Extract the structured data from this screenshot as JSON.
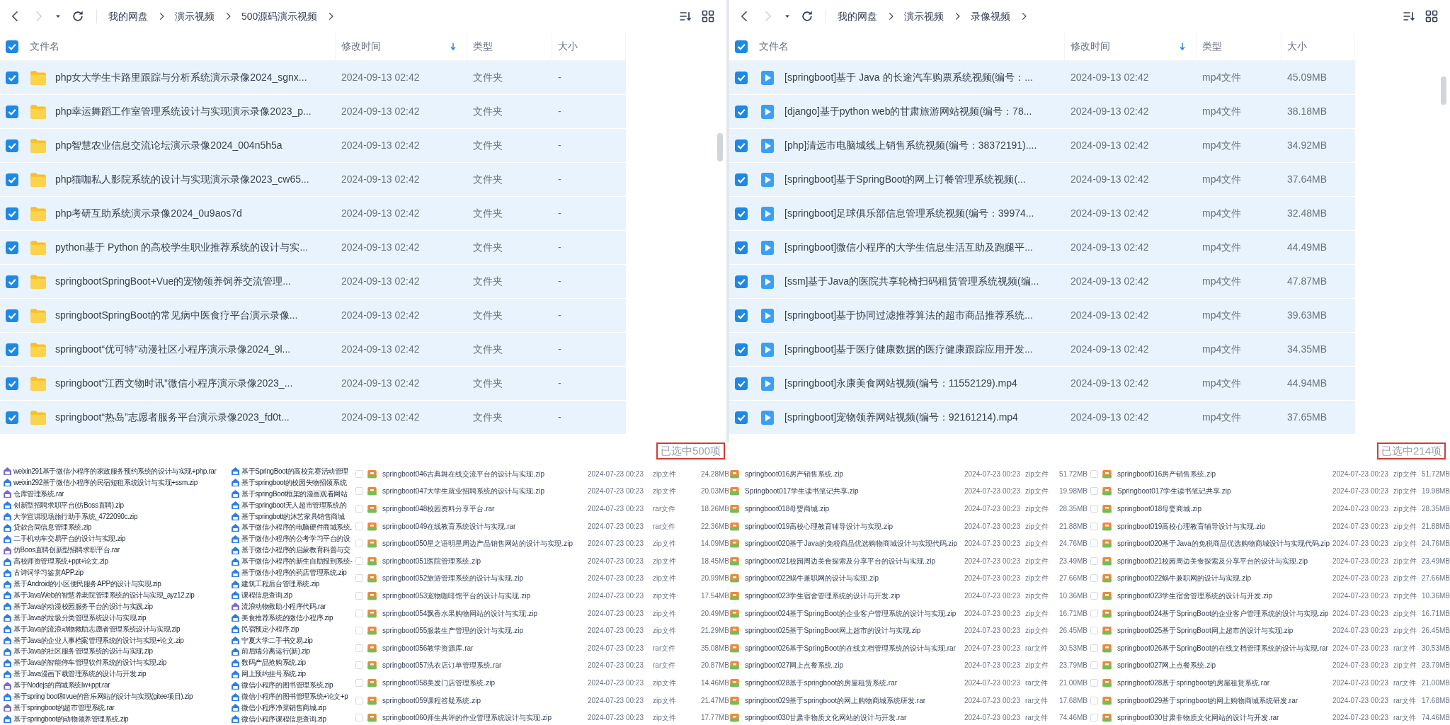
{
  "panels": [
    {
      "breadcrumbs": [
        "我的网盘",
        "演示视频",
        "500源码演示视频"
      ],
      "header": {
        "checked": true,
        "columns": [
          "文件名",
          "修改时间",
          "类型",
          "大小"
        ]
      },
      "rows": [
        {
          "kind": "folder",
          "checked": true,
          "name": "php女大学生卡路里跟踪与分析系统演示录像2024_sgnx...",
          "modified": "2024-09-13 02:42",
          "type": "文件夹",
          "size": "-"
        },
        {
          "kind": "folder",
          "checked": true,
          "name": "php幸运舞蹈工作室管理系统设计与实现演示录像2023_p...",
          "modified": "2024-09-13 02:42",
          "type": "文件夹",
          "size": "-"
        },
        {
          "kind": "folder",
          "checked": true,
          "name": "php智慧农业信息交流论坛演示录像2024_004n5h5a",
          "modified": "2024-09-13 02:42",
          "type": "文件夹",
          "size": "-"
        },
        {
          "kind": "folder",
          "checked": true,
          "name": "php猫咖私人影院系统的设计与实现演示录像2023_cw65...",
          "modified": "2024-09-13 02:42",
          "type": "文件夹",
          "size": "-"
        },
        {
          "kind": "folder",
          "checked": true,
          "name": "php考研互助系统演示录像2024_0u9aos7d",
          "modified": "2024-09-13 02:42",
          "type": "文件夹",
          "size": "-"
        },
        {
          "kind": "folder",
          "checked": true,
          "name": "python基于 Python 的高校学生职业推荐系统的设计与实...",
          "modified": "2024-09-13 02:42",
          "type": "文件夹",
          "size": "-"
        },
        {
          "kind": "folder",
          "checked": true,
          "name": "springbootSpringBoot+Vue的宠物领养饲养交流管理...",
          "modified": "2024-09-13 02:42",
          "type": "文件夹",
          "size": "-"
        },
        {
          "kind": "folder",
          "checked": true,
          "name": "springbootSpringBoot的常见病中医食疗平台演示录像...",
          "modified": "2024-09-13 02:42",
          "type": "文件夹",
          "size": "-"
        },
        {
          "kind": "folder",
          "checked": true,
          "name": "springboot“优可特”动漫社区小程序演示录像2024_9l...",
          "modified": "2024-09-13 02:42",
          "type": "文件夹",
          "size": "-"
        },
        {
          "kind": "folder",
          "checked": true,
          "name": "springboot“江西文物时讯”微信小程序演示录像2023_...",
          "modified": "2024-09-13 02:42",
          "type": "文件夹",
          "size": "-"
        },
        {
          "kind": "folder",
          "checked": true,
          "name": "springboot“热岛”志愿者服务平台演示录像2023_fd0t...",
          "modified": "2024-09-13 02:42",
          "type": "文件夹",
          "size": "-"
        }
      ],
      "selection_count": "已选中500项"
    },
    {
      "breadcrumbs": [
        "我的网盘",
        "演示视频",
        "录像视频"
      ],
      "header": {
        "checked": true,
        "columns": [
          "文件名",
          "修改时间",
          "类型",
          "大小"
        ]
      },
      "rows": [
        {
          "kind": "video",
          "checked": true,
          "name": "[springboot]基于 Java 的长途汽车购票系统视频(编号：...",
          "modified": "2024-09-13 02:42",
          "type": "mp4文件",
          "size": "45.09MB"
        },
        {
          "kind": "video",
          "checked": true,
          "name": "[django]基于python web的甘肃旅游网站视频(编号：78...",
          "modified": "2024-09-13 02:42",
          "type": "mp4文件",
          "size": "38.18MB"
        },
        {
          "kind": "video",
          "checked": true,
          "name": "[php]清远市电脑城线上销售系统视频(编号：38372191)....",
          "modified": "2024-09-13 02:42",
          "type": "mp4文件",
          "size": "34.92MB"
        },
        {
          "kind": "video",
          "checked": true,
          "name": "[springboot]基于SpringBoot的网上订餐管理系统视频(...",
          "modified": "2024-09-13 02:42",
          "type": "mp4文件",
          "size": "37.64MB"
        },
        {
          "kind": "video",
          "checked": true,
          "name": "[springboot]足球俱乐部信息管理系统视频(编号：39974...",
          "modified": "2024-09-13 02:42",
          "type": "mp4文件",
          "size": "32.48MB"
        },
        {
          "kind": "video",
          "checked": true,
          "name": "[springboot]微信小程序的大学生信息生活互助及跑腿平...",
          "modified": "2024-09-13 02:42",
          "type": "mp4文件",
          "size": "44.49MB"
        },
        {
          "kind": "video",
          "checked": true,
          "name": "[ssm]基于Java的医院共享轮椅扫码租赁管理系统视频(编...",
          "modified": "2024-09-13 02:42",
          "type": "mp4文件",
          "size": "47.87MB"
        },
        {
          "kind": "video",
          "checked": true,
          "name": "[springboot]基于协同过滤推荐算法的超市商品推荐系统...",
          "modified": "2024-09-13 02:42",
          "type": "mp4文件",
          "size": "39.63MB"
        },
        {
          "kind": "video",
          "checked": true,
          "name": "[springboot]基于医疗健康数据的医疗健康跟踪应用开发...",
          "modified": "2024-09-13 02:42",
          "type": "mp4文件",
          "size": "34.35MB"
        },
        {
          "kind": "video",
          "checked": true,
          "name": "[springboot]永康美食网站视频(编号：11552129).mp4",
          "modified": "2024-09-13 02:42",
          "type": "mp4文件",
          "size": "44.94MB"
        },
        {
          "kind": "video",
          "checked": true,
          "name": "[springboot]宠物领养网站视频(编号：92161214).mp4",
          "modified": "2024-09-13 02:42",
          "type": "mp4文件",
          "size": "37.65MB"
        }
      ],
      "selection_count": "已选中214项"
    }
  ],
  "archive_list_1": [
    {
      "kind": "rar",
      "name": "weixin291基于微信小程序的家政服务预约系统的设计与实现+php.rar"
    },
    {
      "kind": "zip",
      "name": "weixin292基于微信小程序的民宿短租系统设计与实现+ssm.zip"
    },
    {
      "kind": "rar",
      "name": "仓库管理系统.rar"
    },
    {
      "kind": "zip",
      "name": "创新型招聘求职平台(仿Boss直聘).zip"
    },
    {
      "kind": "zip",
      "name": "大学宣讲现场旅行助手系统_4722090c.zip"
    },
    {
      "kind": "zip",
      "name": "贷款合同信息管理系统.zip"
    },
    {
      "kind": "zip",
      "name": "二手机动车交易平台的设计与实现.zip"
    },
    {
      "kind": "rar",
      "name": "仿Boos直聘创新型招聘求职平台.rar"
    },
    {
      "kind": "zip",
      "name": "高校师资管理系统+ppt+论文.zip"
    },
    {
      "kind": "zip",
      "name": "古诗词学习鉴赏APP.zip"
    },
    {
      "kind": "zip",
      "name": "基于Android的小区便民服务APP的设计与实现.zip"
    },
    {
      "kind": "zip",
      "name": "基于JavaWeb的智慧养老院管理系统的设计与实现_ayz12.zip"
    },
    {
      "kind": "zip",
      "name": "基于Java的动漫校园服务平台的设计与实践.zip"
    },
    {
      "kind": "zip",
      "name": "基于Java的垃圾分类管理系统设计与实现.zip"
    },
    {
      "kind": "zip",
      "name": "基于Java的流浪动物救助志愿者管理系统设计与实现.zip"
    },
    {
      "kind": "zip",
      "name": "基于Java的企业人事档案管理系统的设计与实现+论文.zip"
    },
    {
      "kind": "zip",
      "name": "基于Java的社区服务管理系统的设计与实现.zip"
    },
    {
      "kind": "zip",
      "name": "基于Java的智能停车管理软件系统的设计与实现.zip"
    },
    {
      "kind": "zip",
      "name": "基于Java漫画下载管理系统的设计与开发.zip"
    },
    {
      "kind": "rar",
      "name": "基于Nodejs的商城系统lw+ppt.rar"
    },
    {
      "kind": "zip",
      "name": "基于spring boot和vue的音乐网站的设计与实现(gitee项目).zip"
    },
    {
      "kind": "rar",
      "name": "基于springboot的超市管理系统.rar"
    },
    {
      "kind": "zip",
      "name": "基于springboot的动物领养管理系统.zip"
    }
  ],
  "archive_list_2": [
    {
      "kind": "zip",
      "name": "基于SpringBoot的高校竞赛活动管理"
    },
    {
      "kind": "zip",
      "name": "基于springboot的校园失物招领系统"
    },
    {
      "kind": "zip",
      "name": "基于springBoot框架的漫画观看网站"
    },
    {
      "kind": "zip",
      "name": "基于springboot无人超市管理系统的"
    },
    {
      "kind": "zip",
      "name": "基于springbott的沐艺家具销售商城"
    },
    {
      "kind": "zip",
      "name": "基于微信小程序的电脑硬件商城系统."
    },
    {
      "kind": "zip",
      "name": "基于微信小程序的公考学习平台的设"
    },
    {
      "kind": "zip",
      "name": "基于微信小程序的启蒙教育科普与交"
    },
    {
      "kind": "zip",
      "name": "基于微信小程序的新生自助报到系统-"
    },
    {
      "kind": "zip",
      "name": "基于微信小程序的药店管理系统.zip"
    },
    {
      "kind": "zip",
      "name": "建筑工程后台管理系统.zip"
    },
    {
      "kind": "zip",
      "name": "课程信息查询.zip"
    },
    {
      "kind": "rar",
      "name": "流浪动物救助小程序代码.rar"
    },
    {
      "kind": "zip",
      "name": "美食推荐系统的微信小程序.zip"
    },
    {
      "kind": "zip",
      "name": "民宿预定小程序.zip"
    },
    {
      "kind": "zip",
      "name": "宁夏大学二手书交易.zip"
    },
    {
      "kind": "zip",
      "name": "前后端分离运行(新).zip"
    },
    {
      "kind": "zip",
      "name": "数码产品抢购系统.zip"
    },
    {
      "kind": "zip",
      "name": "网上预约挂号系统.zip"
    },
    {
      "kind": "zip",
      "name": "微信小程序的图书管理系统.zip"
    },
    {
      "kind": "zip",
      "name": "微信小程序的图书管理系统+论文+p"
    },
    {
      "kind": "zip",
      "name": "微信小程序净菜销售商城.zip"
    },
    {
      "kind": "zip",
      "name": "微信小程序课程信息查询.zip"
    }
  ],
  "archive_tables": [
    {
      "rows": [
        {
          "checked": false,
          "name": "springboot046古典舞在线交流平台的设计与实现.zip",
          "modified": "2024-07-23 00:23",
          "type": "zip文件",
          "size": "24.28MB"
        },
        {
          "checked": false,
          "name": "springboot047大学生就业招聘系统的设计与实现.zip",
          "modified": "2024-07-23 00:23",
          "type": "zip文件",
          "size": "20.03MB"
        },
        {
          "checked": false,
          "name": "springboot048校园资料分享平台.rar",
          "modified": "2024-07-23 00:23",
          "type": "rar文件",
          "size": "18.26MB"
        },
        {
          "checked": false,
          "name": "springboot049在线教育系统设计与实现.rar",
          "modified": "2024-07-23 00:23",
          "type": "rar文件",
          "size": "22.36MB"
        },
        {
          "checked": false,
          "name": "springboot050星之语明星周边产品销售网站的设计与实现.zip",
          "modified": "2024-07-23 00:23",
          "type": "zip文件",
          "size": "14.09MB"
        },
        {
          "checked": false,
          "name": "springboot051医院管理系统.zip",
          "modified": "2024-07-23 00:23",
          "type": "zip文件",
          "size": "18.45MB"
        },
        {
          "checked": false,
          "name": "springboot052旅游管理系统的设计与实现.zip",
          "modified": "2024-07-23 00:23",
          "type": "zip文件",
          "size": "20.99MB"
        },
        {
          "checked": false,
          "name": "springboot053宠物咖啡馆平台的设计与实现.zip",
          "modified": "2024-07-23 00:23",
          "type": "zip文件",
          "size": "17.54MB"
        },
        {
          "checked": false,
          "name": "springboot054飘香水果购物网站的设计与实现.zip",
          "modified": "2024-07-23 00:23",
          "type": "zip文件",
          "size": "20.49MB"
        },
        {
          "checked": false,
          "name": "springboot055服装生产管理的设计与实现.zip",
          "modified": "2024-07-23 00:23",
          "type": "zip文件",
          "size": "21.29MB"
        },
        {
          "checked": false,
          "name": "springboot056教学资源库.rar",
          "modified": "2024-07-23 00:23",
          "type": "rar文件",
          "size": "35.08MB"
        },
        {
          "checked": false,
          "name": "springboot057洗衣店订单管理系统.rar",
          "modified": "2024-07-23 00:23",
          "type": "rar文件",
          "size": "20.87MB"
        },
        {
          "checked": false,
          "name": "springboot058美发门店管理系统.zip",
          "modified": "2024-07-23 00:23",
          "type": "zip文件",
          "size": "14.46MB"
        },
        {
          "checked": false,
          "name": "springboot059课程答疑系统.zip",
          "modified": "2024-07-23 00:23",
          "type": "zip文件",
          "size": "21.47MB"
        },
        {
          "checked": false,
          "name": "springboot060师生共评的作业管理系统设计与实现.zip",
          "modified": "2024-07-23 00:23",
          "type": "zip文件",
          "size": "17.77MB"
        }
      ]
    },
    {
      "rows": [
        {
          "name": "springboot016房产销售系统.zip",
          "modified": "2024-07-23 00:23",
          "type": "zip文件",
          "size": "51.72MB"
        },
        {
          "name": "Springboot017学生读书笔记共享.zip",
          "modified": "2024-07-23 00:23",
          "type": "zip文件",
          "size": "19.98MB"
        },
        {
          "name": "springboot018母婴商城.zip",
          "modified": "2024-07-23 00:23",
          "type": "zip文件",
          "size": "28.35MB"
        },
        {
          "name": "springboot019高校心理教育辅导设计与实现.zip",
          "modified": "2024-07-23 00:23",
          "type": "zip文件",
          "size": "21.88MB"
        },
        {
          "name": "springboot020基于Java的免税商品优选购物商城设计与实现代码.zip",
          "modified": "2024-07-23 00:23",
          "type": "zip文件",
          "size": "24.76MB"
        },
        {
          "name": "springboot021校园周边美食探索及分享平台的设计与实现.zip",
          "modified": "2024-07-23 00:23",
          "type": "zip文件",
          "size": "23.49MB"
        },
        {
          "name": "springboot022蜗牛兼职网的设计与实现.zip",
          "modified": "2024-07-23 00:23",
          "type": "zip文件",
          "size": "27.66MB"
        },
        {
          "name": "springboot023学生宿舍管理系统的设计与开发.zip",
          "modified": "2024-07-23 00:23",
          "type": "zip文件",
          "size": "10.36MB"
        },
        {
          "name": "springboot024基于SpringBoot的企业客户管理系统的设计与实现.zip",
          "modified": "2024-07-23 00:23",
          "type": "zip文件",
          "size": "16.71MB"
        },
        {
          "name": "springboot025基于SpringBoot网上超市的设计与实现.zip",
          "modified": "2024-07-23 00:23",
          "type": "zip文件",
          "size": "26.45MB"
        },
        {
          "name": "springboot026基于SpringBoot的在线文档管理系统的设计与实现.rar",
          "modified": "2024-07-23 00:23",
          "type": "rar文件",
          "size": "30.53MB"
        },
        {
          "name": "springboot027网上点餐系统.zip",
          "modified": "2024-07-23 00:23",
          "type": "zip文件",
          "size": "23.79MB"
        },
        {
          "name": "springboot028基于springboot的房屋租赁系统.rar",
          "modified": "2024-07-23 00:23",
          "type": "rar文件",
          "size": "21.00MB"
        },
        {
          "name": "springboot029基于springboot的网上购物商城系统研发.rar",
          "modified": "2024-07-23 00:23",
          "type": "rar文件",
          "size": "17.68MB"
        },
        {
          "name": "springboot030甘肃非物质文化网站的设计与开发.rar",
          "modified": "2024-07-23 00:23",
          "type": "rar文件",
          "size": "74.46MB"
        }
      ]
    },
    {
      "rows": [
        {
          "checked": false,
          "name": "springboot016房产销售系统.zip",
          "modified": "2024-07-23 00:23",
          "type": "zip文件",
          "size": "51.72MB"
        },
        {
          "checked": false,
          "name": "Springboot017学生读书笔记共享.zip",
          "modified": "2024-07-23 00:23",
          "type": "zip文件",
          "size": "19.98MB"
        },
        {
          "checked": false,
          "name": "springboot018母婴商城.zip",
          "modified": "2024-07-23 00:23",
          "type": "zip文件",
          "size": "28.35MB"
        },
        {
          "checked": false,
          "name": "springboot019高校心理教育辅导设计与实现.zip",
          "modified": "2024-07-23 00:23",
          "type": "zip文件",
          "size": "21.88MB"
        },
        {
          "checked": false,
          "name": "springboot020基于Java的免税商品优选购物商城设计与实现代码.zip",
          "modified": "2024-07-23 00:23",
          "type": "zip文件",
          "size": "24.76MB"
        },
        {
          "checked": false,
          "name": "springboot021校园周边美食探索及分享平台的设计与实现.zip",
          "modified": "2024-07-23 00:23",
          "type": "zip文件",
          "size": "23.49MB"
        },
        {
          "checked": false,
          "name": "springboot022蜗牛兼职网的设计与实现.zip",
          "modified": "2024-07-23 00:23",
          "type": "zip文件",
          "size": "27.66MB"
        },
        {
          "checked": false,
          "name": "springboot023学生宿舍管理系统的设计与开发.zip",
          "modified": "2024-07-23 00:23",
          "type": "zip文件",
          "size": "10.36MB"
        },
        {
          "checked": false,
          "name": "springboot024基于SpringBoot的企业客户管理系统的设计与实现.zip",
          "modified": "2024-07-23 00:23",
          "type": "zip文件",
          "size": "16.71MB"
        },
        {
          "checked": false,
          "name": "springboot025基于SpringBoot网上超市的设计与实现.zip",
          "modified": "2024-07-23 00:23",
          "type": "zip文件",
          "size": "26.45MB"
        },
        {
          "checked": false,
          "name": "springboot026基于SpringBoot的在线文档管理系统的设计与实现.rar",
          "modified": "2024-07-23 00:23",
          "type": "rar文件",
          "size": "30.53MB"
        },
        {
          "checked": false,
          "name": "springboot027网上点餐系统.zip",
          "modified": "2024-07-23 00:23",
          "type": "zip文件",
          "size": "23.79MB"
        },
        {
          "checked": false,
          "name": "springboot028基于springboot的房屋租赁系统.rar",
          "modified": "2024-07-23 00:23",
          "type": "rar文件",
          "size": "21.00MB"
        },
        {
          "checked": false,
          "name": "springboot029基于springboot的网上购物商城系统研发.rar",
          "modified": "2024-07-23 00:23",
          "type": "rar文件",
          "size": "17.68MB"
        },
        {
          "checked": false,
          "name": "springboot030甘肃非物质文化网站的设计与开发.rar",
          "modified": "2024-07-23 00:23",
          "type": "rar文件",
          "size": "74.46MB"
        }
      ]
    }
  ]
}
